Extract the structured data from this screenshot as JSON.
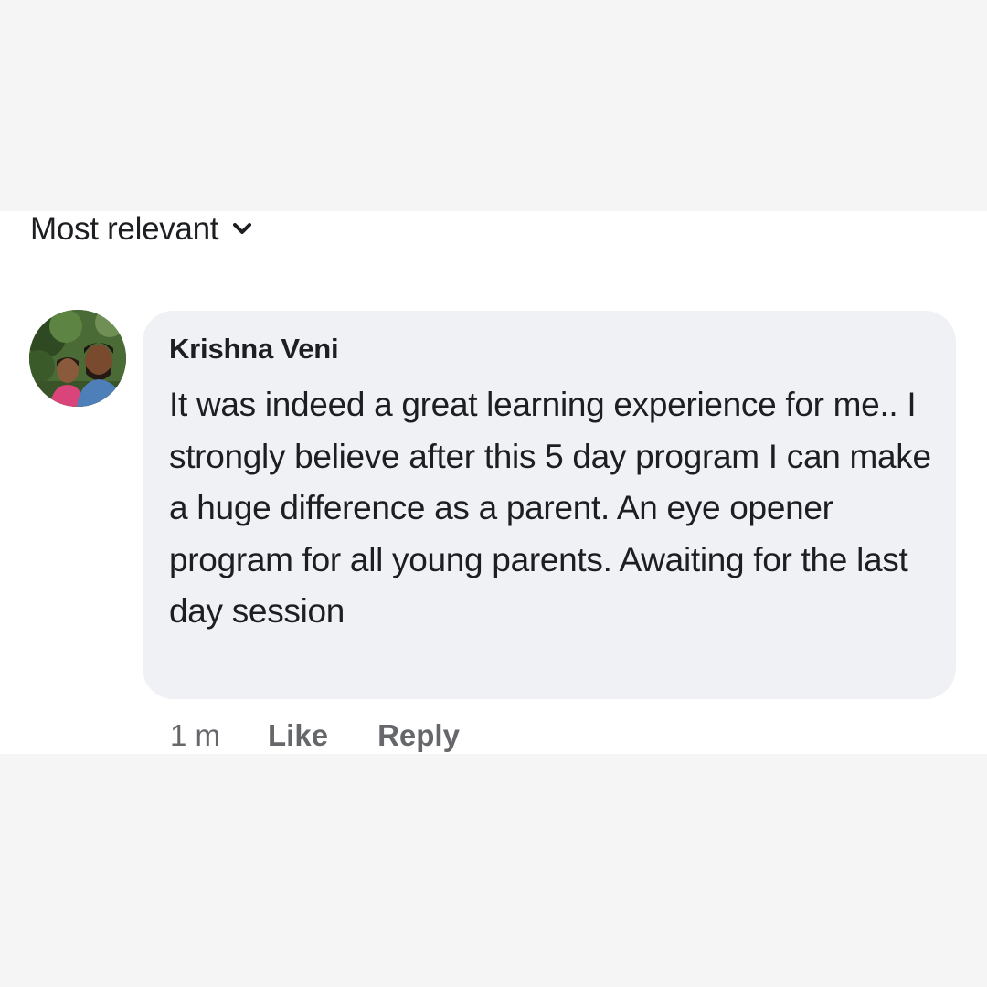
{
  "sort": {
    "label": "Most relevant",
    "icon": "chevron-down-icon"
  },
  "comment": {
    "author": "Krishna Veni",
    "text": "It was indeed a great learning experience for me.. I strongly believe after this 5 day program I can make a huge difference as a parent. An eye opener program for all young parents. Awaiting for the last day session",
    "timestamp": "1 m",
    "like_label": "Like",
    "reply_label": "Reply"
  },
  "colors": {
    "page_background": "#f5f5f6",
    "card_background": "#ffffff",
    "bubble_background": "#f0f1f4",
    "primary_text": "#1c1e21",
    "secondary_text": "#65676b"
  }
}
